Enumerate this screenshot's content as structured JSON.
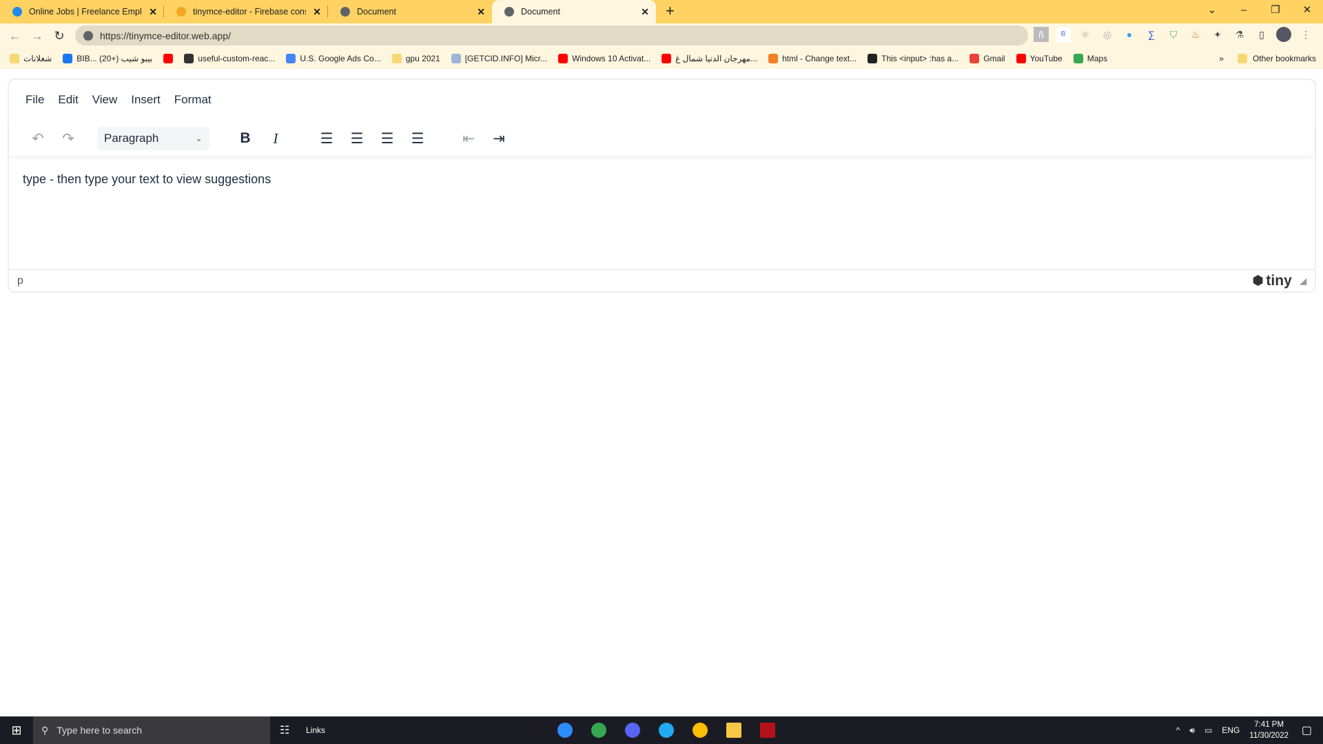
{
  "browser": {
    "tabs": [
      {
        "title": "Online Jobs | Freelance Employm",
        "icon": "upwork-icon",
        "active": false
      },
      {
        "title": "tinymce-editor - Firebase consol",
        "icon": "firebase-icon",
        "active": false
      },
      {
        "title": "Document",
        "icon": "globe-icon",
        "active": false
      },
      {
        "title": "Document",
        "icon": "globe-icon",
        "active": true
      }
    ],
    "new_tab": "+",
    "url": "https://tinymce-editor.web.app/",
    "bookmarks": [
      {
        "label": "شغلانات",
        "color": "#f7d774"
      },
      {
        "label": "BIB... بيبو شيب (+20)",
        "color": "#1877f2"
      },
      {
        "label": "",
        "color": "#ff0000"
      },
      {
        "label": "useful-custom-reac...",
        "color": "#333333"
      },
      {
        "label": "U.S. Google Ads Co...",
        "color": "#4285f4"
      },
      {
        "label": "gpu 2021",
        "color": "#f7d774"
      },
      {
        "label": "[GETCID.INFO] Micr...",
        "color": "#9db4d6"
      },
      {
        "label": "Windows 10 Activat...",
        "color": "#ff0000"
      },
      {
        "label": "مهرجان الدنيا شمال غ...",
        "color": "#ff0000"
      },
      {
        "label": "html - Change text...",
        "color": "#f48024"
      },
      {
        "label": "This <input> :has a...",
        "color": "#222222"
      },
      {
        "label": "Gmail",
        "color": "#ea4335"
      },
      {
        "label": "YouTube",
        "color": "#ff0000"
      },
      {
        "label": "Maps",
        "color": "#34a853"
      }
    ],
    "more_bookmarks": "»",
    "other_bookmarks": "Other bookmarks"
  },
  "editor": {
    "menu": [
      "File",
      "Edit",
      "View",
      "Insert",
      "Format"
    ],
    "block_format": "Paragraph",
    "content": "type - then type your text to view suggestions",
    "status_path": "p",
    "brand": "tiny"
  },
  "taskbar": {
    "search_placeholder": "Type here to search",
    "links": "Links",
    "lang": "ENG",
    "time": "7:41 PM",
    "date": "11/30/2022",
    "apps": [
      {
        "name": "zoom",
        "color": "#2d8cff"
      },
      {
        "name": "chrome",
        "color": "#34a853"
      },
      {
        "name": "discord",
        "color": "#5865f2"
      },
      {
        "name": "vscode",
        "color": "#23a9f2"
      },
      {
        "name": "chrome-canary",
        "color": "#fbbc04"
      },
      {
        "name": "file-explorer",
        "color": "#f8c846"
      },
      {
        "name": "app",
        "color": "#b3121b"
      }
    ]
  },
  "colors": {
    "tabbar": "#ffd262",
    "toolbar_bg": "#fff6df",
    "editor_text": "#222f3e",
    "taskbar": "#1b1c23"
  }
}
